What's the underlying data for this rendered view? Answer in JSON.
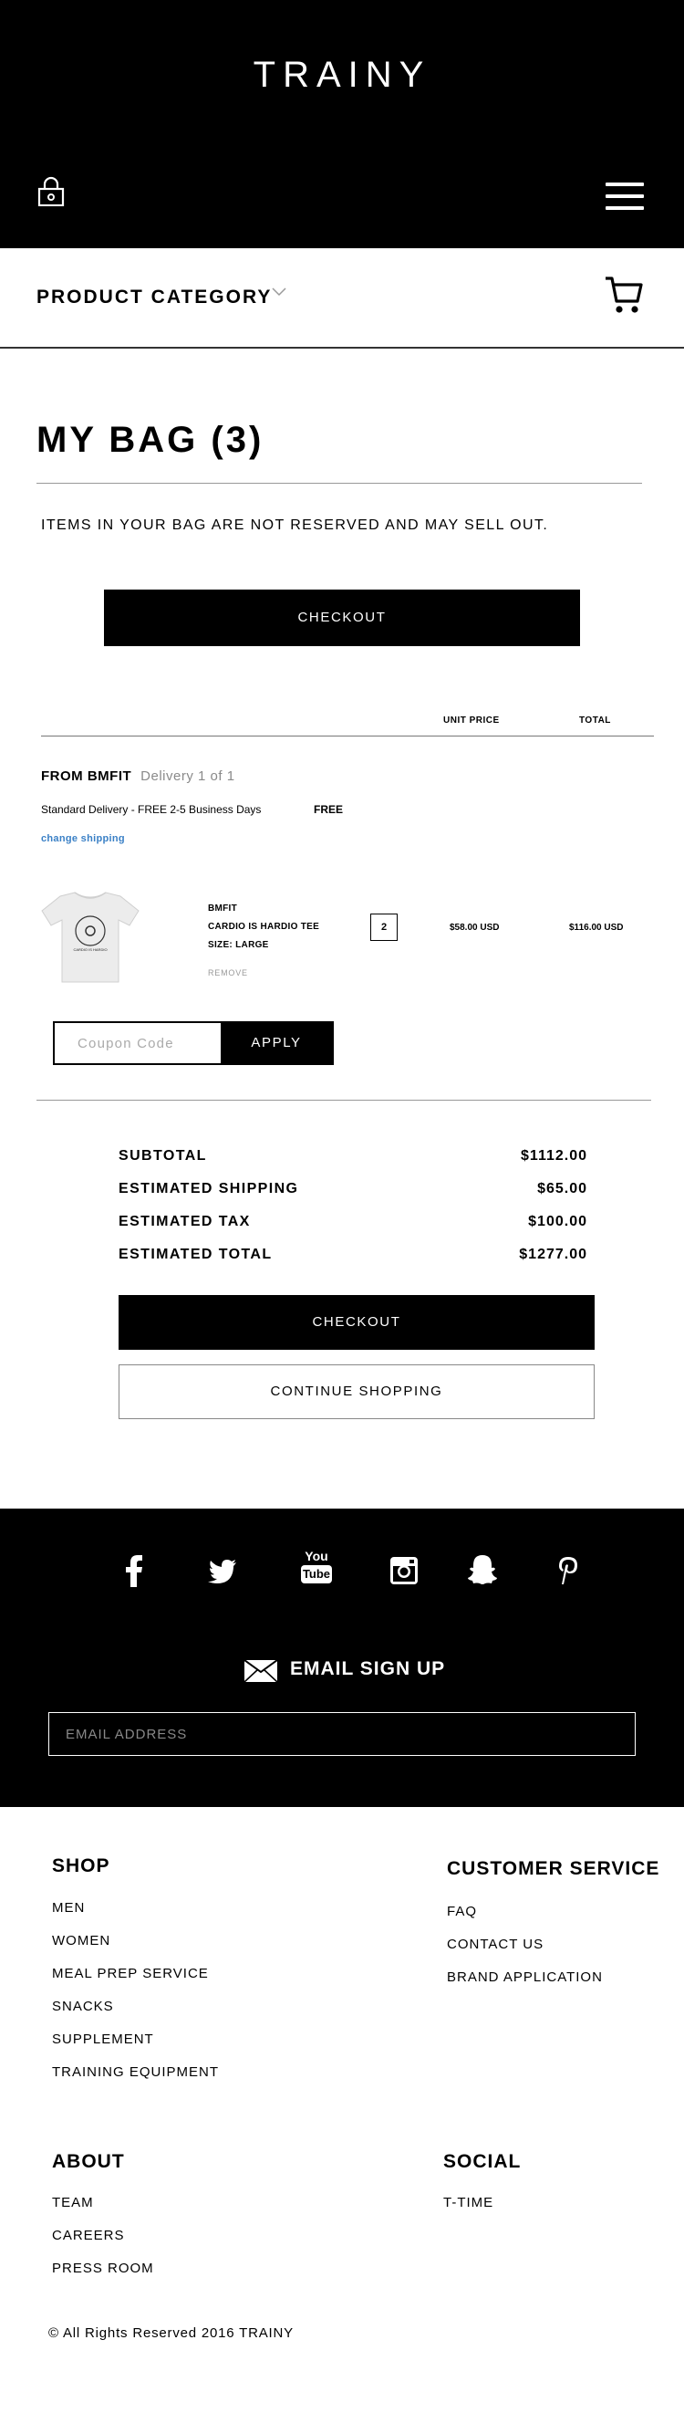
{
  "header": {
    "brand": "TRAINY",
    "icons": {
      "lock": "lock-icon",
      "menu": "hamburger-menu-icon"
    }
  },
  "category": {
    "label": "PRODUCT CATEGORY",
    "icons": {
      "chevron": "chevron-down-icon",
      "cart": "cart-icon"
    }
  },
  "bag": {
    "title": "MY BAG (3)",
    "notice": "ITEMS IN YOUR BAG ARE NOT RESERVED AND MAY SELL OUT.",
    "checkout_label": "CHECKOUT",
    "columns": {
      "unit_price": "UNIT PRICE",
      "total": "TOTAL"
    }
  },
  "shipment": {
    "from": "FROM BMFIT",
    "delivery": "Delivery 1 of 1",
    "standard": "Standard Delivery  - FREE 2-5 Business Days",
    "free": "FREE",
    "change": "change shipping"
  },
  "item": {
    "brand": "BMFIT",
    "name": "CARDIO IS HARDIO TEE",
    "size": "SIZE: LARGE",
    "remove": "REMOVE",
    "quantity": "2",
    "unit_price": "$58.00 USD",
    "total": "$116.00 USD",
    "print_text": "CARDIO IS HARDIO"
  },
  "coupon": {
    "placeholder": "Coupon Code",
    "apply": "APPLY"
  },
  "summary": {
    "subtotal_label": "SUBTOTAL",
    "subtotal": "$1112.00",
    "shipping_label": "ESTIMATED SHIPPING",
    "shipping": "$65.00",
    "tax_label": "ESTIMATED TAX",
    "tax": "$100.00",
    "total_label": "ESTIMATED TOTAL",
    "total": "$1277.00"
  },
  "actions": {
    "checkout": "CHECKOUT",
    "continue": "CONTINUE SHOPPING"
  },
  "footer": {
    "social_icons": [
      "facebook-icon",
      "twitter-icon",
      "youtube-icon",
      "instagram-icon",
      "snapchat-icon",
      "pinterest-icon"
    ],
    "youtube_text": {
      "you": "You",
      "tube": "Tube"
    },
    "signup": "EMAIL SIGN UP",
    "email_placeholder": "EMAIL ADDRESS",
    "shop": {
      "heading": "SHOP",
      "items": [
        "MEN",
        "WOMEN",
        "MEAL PREP SERVICE",
        "SNACKS",
        "SUPPLEMENT",
        "TRAINING EQUIPMENT"
      ]
    },
    "customer_service": {
      "heading": "CUSTOMER SERVICE",
      "items": [
        "FAQ",
        "CONTACT US",
        "BRAND APPLICATION"
      ]
    },
    "about": {
      "heading": "ABOUT",
      "items": [
        "TEAM",
        "CAREERS",
        "PRESS ROOM"
      ]
    },
    "social": {
      "heading": "SOCIAL",
      "items": [
        "T-TIME"
      ]
    },
    "copyright": "© All Rights Reserved 2016 TRAINY"
  }
}
